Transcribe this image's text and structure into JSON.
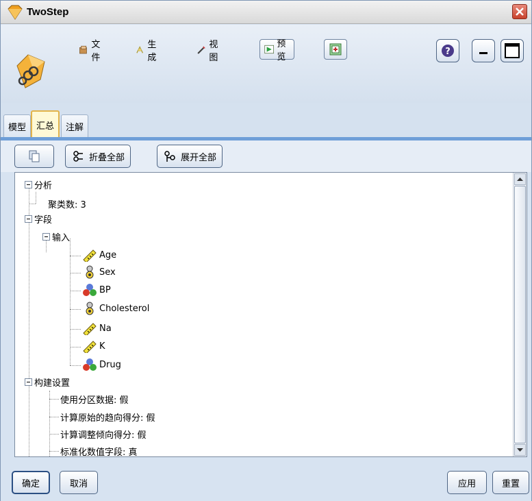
{
  "window": {
    "title": "TwoStep"
  },
  "toolbar": {
    "file": "文件",
    "generate": "生成",
    "view": "视图",
    "preview": "预览"
  },
  "tabs": [
    {
      "label": "模型"
    },
    {
      "label": "汇总"
    },
    {
      "label": "注解"
    }
  ],
  "subbar": {
    "collapse_all": "折叠全部",
    "expand_all": "展开全部"
  },
  "tree": {
    "analysis": {
      "label": "分析",
      "children": [
        "聚类数: 3"
      ]
    },
    "fields": {
      "label": "字段",
      "input": {
        "label": "输入",
        "items": [
          {
            "name": "Age",
            "icon": "continuous-ruler-icon"
          },
          {
            "name": "Sex",
            "icon": "flag-categorical-icon"
          },
          {
            "name": "BP",
            "icon": "nominal-balls-icon"
          },
          {
            "name": "Cholesterol",
            "icon": "flag-categorical-icon"
          },
          {
            "name": "Na",
            "icon": "continuous-ruler-icon"
          },
          {
            "name": "K",
            "icon": "continuous-ruler-icon"
          },
          {
            "name": "Drug",
            "icon": "nominal-balls-icon"
          }
        ]
      }
    },
    "build_settings": {
      "label": "构建设置",
      "children": [
        "使用分区数据: 假",
        "计算原始的趋向得分: 假",
        "计算调整倾向得分: 假",
        "标准化数值字段: 真"
      ]
    }
  },
  "buttons": {
    "ok": "确定",
    "cancel": "取消",
    "apply": "应用",
    "reset": "重置"
  }
}
